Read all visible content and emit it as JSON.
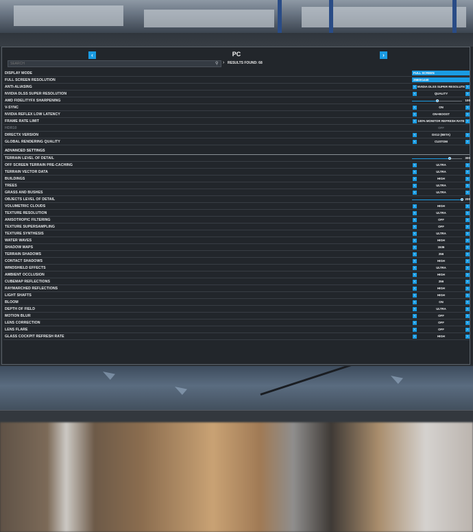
{
  "colors": {
    "accent": "#1a9be2",
    "panel": "#22262b",
    "text": "#e6e8ea",
    "disabled": "#6a7077"
  },
  "header": {
    "title": "PC",
    "prev_icon": "chevron-left-icon",
    "next_icon": "chevron-right-icon",
    "search_placeholder": "SEARCH",
    "results_found": "RESULTS FOUND: 68"
  },
  "graphics": [
    {
      "label": "DISPLAY MODE",
      "value": "FULL SCREEN",
      "control": "field"
    },
    {
      "label": "FULL SCREEN RESOLUTION",
      "value": "2560X1440",
      "control": "field"
    },
    {
      "label": "ANTI-ALIASING",
      "value": "NVIDIA DLSS SUPER RESOLUTION",
      "control": "select"
    },
    {
      "label": "NVIDIA DLSS SUPER RESOLUTION",
      "value": "QUALITY",
      "control": "select"
    },
    {
      "label": "AMD FIDELITYFX SHARPENING",
      "value": "100",
      "control": "slider",
      "fraction": 0.5
    },
    {
      "label": "V-SYNC",
      "value": "ON",
      "control": "select"
    },
    {
      "label": "NVIDIA REFLEX LOW LATENCY",
      "value": "ON+BOOST",
      "control": "select"
    },
    {
      "label": "FRAME RATE LIMIT",
      "value": "100% MONITOR REFRESH RATE",
      "control": "select"
    },
    {
      "label": "HDR10",
      "value": "OFF",
      "control": "select",
      "disabled": true
    },
    {
      "label": "DIRECTX VERSION",
      "value": "DX12 (BETA)",
      "control": "select"
    },
    {
      "label": "GLOBAL RENDERING QUALITY",
      "value": "CUSTOM",
      "control": "select"
    }
  ],
  "advanced_title": "ADVANCED SETTINGS",
  "advanced": [
    {
      "label": "TERRAIN LEVEL OF DETAIL",
      "value": "300",
      "control": "slider",
      "fraction": 0.75
    },
    {
      "label": "OFF SCREEN TERRAIN PRE-CACHING",
      "value": "ULTRA",
      "control": "select"
    },
    {
      "label": "TERRAIN VECTOR DATA",
      "value": "ULTRA",
      "control": "select"
    },
    {
      "label": "BUILDINGS",
      "value": "HIGH",
      "control": "select"
    },
    {
      "label": "TREES",
      "value": "ULTRA",
      "control": "select"
    },
    {
      "label": "GRASS AND BUSHES",
      "value": "ULTRA",
      "control": "select"
    },
    {
      "label": "OBJECTS LEVEL OF DETAIL",
      "value": "200",
      "control": "slider",
      "fraction": 1.0
    },
    {
      "label": "VOLUMETRIC CLOUDS",
      "value": "HIGH",
      "control": "select"
    },
    {
      "label": "TEXTURE RESOLUTION",
      "value": "ULTRA",
      "control": "select"
    },
    {
      "label": "ANISOTROPIC FILTERING",
      "value": "OFF",
      "control": "select"
    },
    {
      "label": "TEXTURE SUPERSAMPLING",
      "value": "OFF",
      "control": "select"
    },
    {
      "label": "TEXTURE SYNTHESIS",
      "value": "ULTRA",
      "control": "select"
    },
    {
      "label": "WATER WAVES",
      "value": "HIGH",
      "control": "select"
    },
    {
      "label": "SHADOW MAPS",
      "value": "1536",
      "control": "select"
    },
    {
      "label": "TERRAIN SHADOWS",
      "value": "256",
      "control": "select"
    },
    {
      "label": "CONTACT SHADOWS",
      "value": "HIGH",
      "control": "select"
    },
    {
      "label": "WINDSHIELD EFFECTS",
      "value": "ULTRA",
      "control": "select"
    },
    {
      "label": "AMBIENT OCCLUSION",
      "value": "HIGH",
      "control": "select"
    },
    {
      "label": "CUBEMAP REFLECTIONS",
      "value": "256",
      "control": "select"
    },
    {
      "label": "RAYMARCHED REFLECTIONS",
      "value": "HIGH",
      "control": "select"
    },
    {
      "label": "LIGHT SHAFTS",
      "value": "HIGH",
      "control": "select"
    },
    {
      "label": "BLOOM",
      "value": "ON",
      "control": "select"
    },
    {
      "label": "DEPTH OF FIELD",
      "value": "ULTRA",
      "control": "select"
    },
    {
      "label": "MOTION BLUR",
      "value": "OFF",
      "control": "select"
    },
    {
      "label": "LENS CORRECTION",
      "value": "OFF",
      "control": "select"
    },
    {
      "label": "LENS FLARE",
      "value": "OFF",
      "control": "select"
    },
    {
      "label": "GLASS COCKPIT REFRESH RATE",
      "value": "HIGH",
      "control": "select"
    }
  ]
}
